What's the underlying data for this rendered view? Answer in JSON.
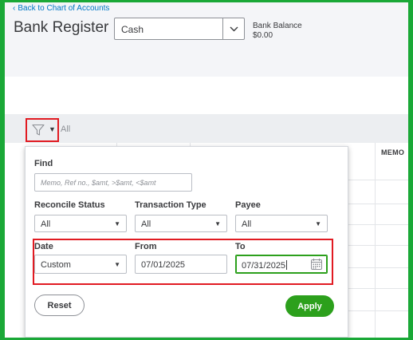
{
  "header": {
    "back_link": "Back to Chart of Accounts",
    "title": "Bank Register",
    "account_value": "Cash",
    "balance_label": "Bank Balance",
    "balance_amount": "$0.00"
  },
  "filter_bar": {
    "all_label": "All"
  },
  "table": {
    "memo_header": "MEMO"
  },
  "filter_panel": {
    "find_label": "Find",
    "find_placeholder": "Memo, Ref no., $amt, >$amt, <$amt",
    "reconcile_label": "Reconcile Status",
    "reconcile_value": "All",
    "transaction_type_label": "Transaction Type",
    "transaction_type_value": "All",
    "payee_label": "Payee",
    "payee_value": "All",
    "date_label": "Date",
    "date_value": "Custom",
    "from_label": "From",
    "from_value": "07/01/2025",
    "to_label": "To",
    "to_value": "07/31/2025",
    "reset_label": "Reset",
    "apply_label": "Apply"
  },
  "colors": {
    "accent_green": "#2ca01c",
    "highlight_red": "#e11b22",
    "link_blue": "#0077c5",
    "outer_border": "#1aa837"
  }
}
